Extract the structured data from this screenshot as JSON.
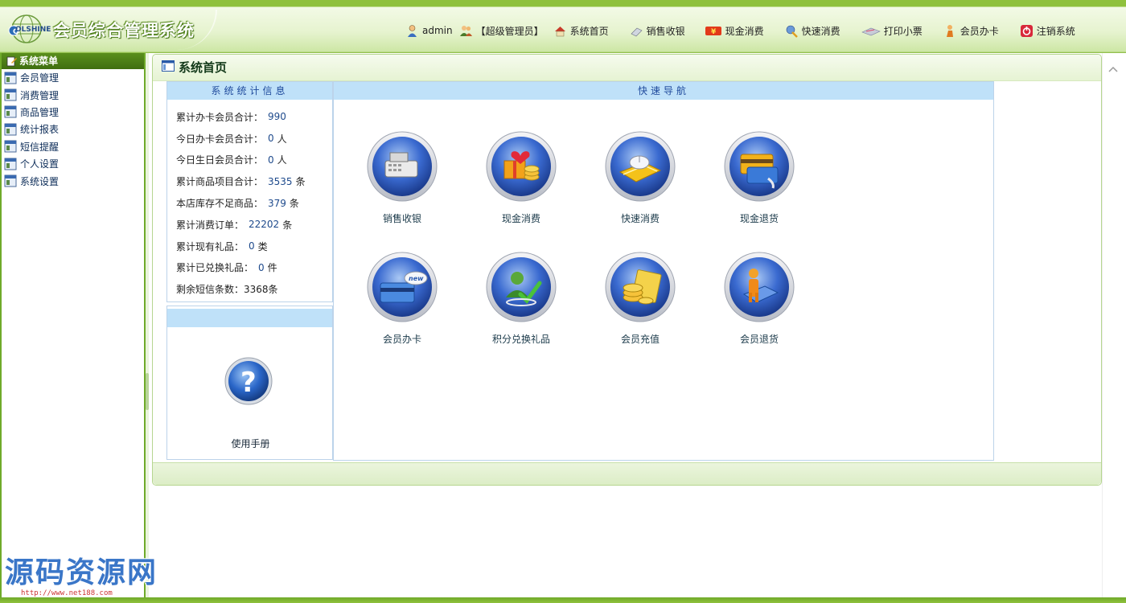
{
  "header": {
    "logo_text": "OLSHINE",
    "title": "会员综合管理系统",
    "user": "admin",
    "role": "【超级管理员】",
    "nav": [
      {
        "label": "系统首页",
        "icon": "home-icon"
      },
      {
        "label": "销售收银",
        "icon": "cashier-icon"
      },
      {
        "label": "现金消费",
        "icon": "yen-icon"
      },
      {
        "label": "快速消费",
        "icon": "pen-icon"
      },
      {
        "label": "打印小票",
        "icon": "print-icon"
      },
      {
        "label": "会员办卡",
        "icon": "member-card-icon"
      },
      {
        "label": "注销系统",
        "icon": "logout-icon"
      }
    ]
  },
  "sidebar": {
    "title": "系统菜单",
    "items": [
      {
        "label": "会员管理"
      },
      {
        "label": "消费管理"
      },
      {
        "label": "商品管理"
      },
      {
        "label": "统计报表"
      },
      {
        "label": "短信提醒"
      },
      {
        "label": "个人设置"
      },
      {
        "label": "系统设置"
      }
    ]
  },
  "main": {
    "title": "系统首页",
    "stats": {
      "title": "系统统计信息",
      "rows": [
        {
          "label": "累计办卡会员合计：",
          "value": "990",
          "unit": ""
        },
        {
          "label": "今日办卡会员合计：",
          "value": "0",
          "unit": "人"
        },
        {
          "label": "今日生日会员合计：",
          "value": "0",
          "unit": "人"
        },
        {
          "label": "累计商品项目合计：",
          "value": "3535",
          "unit": "条"
        },
        {
          "label": "本店库存不足商品：",
          "value": "379",
          "unit": "条"
        },
        {
          "label": "累计消费订单：",
          "value": "22202",
          "unit": "条"
        },
        {
          "label": "累计现有礼品：",
          "value": "0",
          "unit": "类"
        },
        {
          "label": "累计已兑换礼品：",
          "value": "0",
          "unit": "件"
        },
        {
          "label": "剩余短信条数：",
          "value": "3368条",
          "unit": ""
        }
      ]
    },
    "manual": {
      "label": "使用手册"
    },
    "quick": {
      "title": "快速导航",
      "items": [
        {
          "label": "销售收银",
          "icon": "cash-register-icon"
        },
        {
          "label": "现金消费",
          "icon": "gift-coins-icon"
        },
        {
          "label": "快速消费",
          "icon": "card-mouse-icon"
        },
        {
          "label": "现金退货",
          "icon": "card-return-icon"
        },
        {
          "label": "会员办卡",
          "icon": "new-card-icon"
        },
        {
          "label": "积分兑换礼品",
          "icon": "points-exchange-icon"
        },
        {
          "label": "会员充值",
          "icon": "coins-recharge-icon"
        },
        {
          "label": "会员退货",
          "icon": "member-return-icon"
        }
      ]
    }
  },
  "watermark": {
    "text": "源码资源网",
    "url": "http://www.net188.com"
  },
  "colors": {
    "brand_green": "#8fc13d",
    "header_blue": "#bfe1f9",
    "nav_text": "#1f4a9c"
  }
}
